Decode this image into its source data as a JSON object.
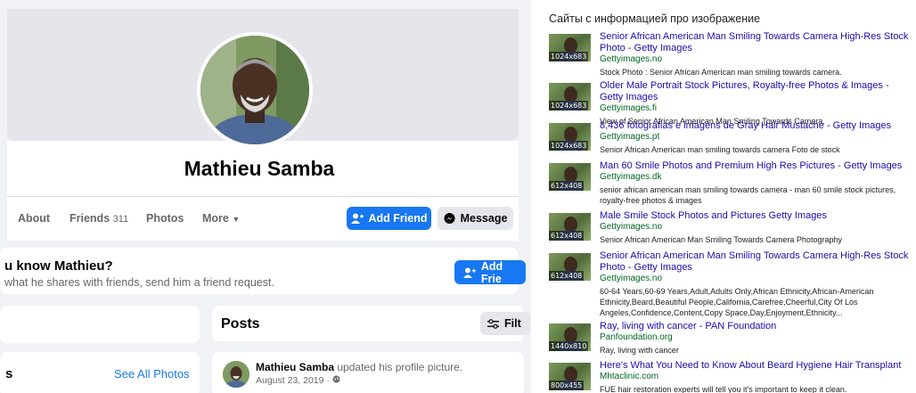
{
  "facebook": {
    "profile_name": "Mathieu Samba",
    "tabs": [
      {
        "label": "About"
      },
      {
        "label": "Friends",
        "count": "311"
      },
      {
        "label": "Photos"
      },
      {
        "label": "More"
      }
    ],
    "add_friend_label": "Add Friend",
    "message_label": "Message",
    "know_title": "u know Mathieu?",
    "know_subtitle": "what he shares with friends, send him a friend request.",
    "know_button_label": "Add Frie",
    "posts_title": "Posts",
    "filters_label": "Filt",
    "photos_heading_partial": "s",
    "see_all_photos": "See All Photos",
    "post": {
      "author": "Mathieu Samba",
      "action": "updated his profile picture.",
      "date": "August 23, 2019 · "
    },
    "colors": {
      "accent": "#1877f2",
      "background": "#f0f2f5"
    }
  },
  "search": {
    "heading": "Сайты с информацией про изображение",
    "results": [
      {
        "dims": "1024x683",
        "title": "Senior African American Man Smiling Towards Camera High-Res Stock Photo - Getty Images",
        "source": "Gettyimages.no",
        "desc": "Stock Photo : Senior African American man smiling towards camera."
      },
      {
        "dims": "1024x683",
        "title": "Older Male Portrait Stock Pictures, Royalty-free Photos & Images - Getty Images",
        "source": "Gettyimages.fi",
        "desc": "View of Senior African American Man Smiling Towards Camera."
      },
      {
        "dims": "1024x683",
        "title": "8,436 fotografias e imagens de Gray Hair Mustache - Getty Images",
        "source": "Gettyimages.pt",
        "desc": "Senior African American man smiling towards camera Foto de stock"
      },
      {
        "dims": "612x408",
        "title": "Man 60 Smile Photos and Premium High Res Pictures - Getty Images",
        "source": "Gettyimages.dk",
        "desc": "senior african american man smiling towards camera - man 60 smile stock pictures, royalty-free photos & images"
      },
      {
        "dims": "612x408",
        "title": "Male Smile Stock Photos and Pictures Getty Images",
        "source": "Gettyimages.no",
        "desc": "Senior African American Man Smiling Towards Camera Photography"
      },
      {
        "dims": "612x408",
        "title": "Senior African American Man Smiling Towards Camera High-Res Stock Photo - Getty Images",
        "source": "Gettyimages.no",
        "desc": "60-64 Years,60-69 Years,Adult,Adults Only,African Ethnicity,African-American Ethnicity,Beard,Beautiful People,California,Carefree,Cheerful,City Of Los Angeles,Confidence,Content,Copy Space,Day,Enjoyment,Ethnicity..."
      },
      {
        "dims": "1440x810",
        "title": "Ray, living with cancer - PAN Foundation",
        "source": "Panfoundation.org",
        "desc": "Ray, living with cancer"
      },
      {
        "dims": "800x455",
        "title": "Here's What You Need to Know About Beard Hygiene Hair Transplant",
        "source": "Mhtaclinic.com",
        "desc": "FUE hair restoration experts will tell you it's important to keep it clean."
      }
    ],
    "colors": {
      "link": "#1a0dab",
      "source": "#006621"
    }
  }
}
